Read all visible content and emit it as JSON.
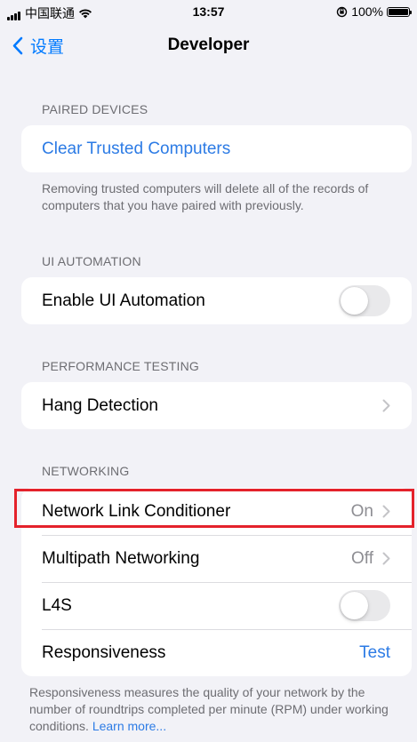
{
  "status_bar": {
    "carrier": "中国联通",
    "time": "13:57",
    "battery": "100%"
  },
  "nav": {
    "back_label": "设置",
    "title": "Developer"
  },
  "sections": {
    "paired": {
      "header": "PAIRED DEVICES",
      "button": "Clear Trusted Computers",
      "footer": "Removing trusted computers will delete all of the records of computers that you have paired with previously."
    },
    "ui_automation": {
      "header": "UI AUTOMATION",
      "label": "Enable UI Automation",
      "enabled": false
    },
    "performance": {
      "header": "PERFORMANCE TESTING",
      "label": "Hang Detection"
    },
    "networking": {
      "header": "NETWORKING",
      "rows": [
        {
          "label": "Network Link Conditioner",
          "value": "On"
        },
        {
          "label": "Multipath Networking",
          "value": "Off"
        },
        {
          "label": "L4S",
          "enabled": false
        },
        {
          "label": "Responsiveness",
          "action": "Test"
        }
      ],
      "footer": "Responsiveness measures the quality of your network by the number of roundtrips completed per minute (RPM) under working conditions.",
      "footer_link": "Learn more..."
    }
  },
  "colors": {
    "accent": "#2c7be5",
    "highlight": "#e4222b",
    "background": "#f2f2f7"
  }
}
